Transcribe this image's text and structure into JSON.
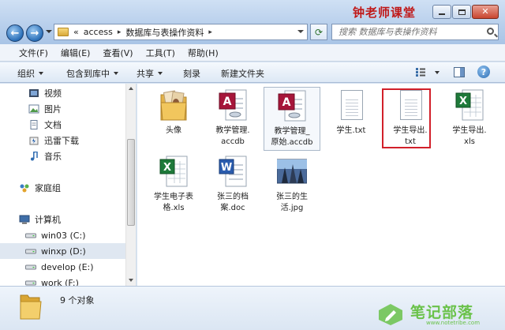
{
  "window": {
    "watermark_title": "钟老师课堂"
  },
  "address": {
    "prefix": "«",
    "crumbs": [
      "access",
      "数据库与表操作资料"
    ],
    "search_placeholder": "搜索 数据库与表操作资料"
  },
  "menu": [
    "文件(F)",
    "编辑(E)",
    "查看(V)",
    "工具(T)",
    "帮助(H)"
  ],
  "commands": {
    "organize": "组织",
    "include": "包含到库中",
    "share": "共享",
    "burn": "刻录",
    "new_folder": "新建文件夹"
  },
  "nav": [
    {
      "label": "视频",
      "icon": "video-icon"
    },
    {
      "label": "图片",
      "icon": "picture-icon"
    },
    {
      "label": "文档",
      "icon": "document-icon"
    },
    {
      "label": "迅雷下载",
      "icon": "thunder-icon"
    },
    {
      "label": "音乐",
      "icon": "music-icon"
    },
    {
      "label": "家庭组",
      "icon": "homegroup-icon"
    },
    {
      "label": "计算机",
      "icon": "computer-icon"
    },
    {
      "label": "win03 (C:)",
      "icon": "drive-icon"
    },
    {
      "label": "winxp (D:)",
      "icon": "drive-icon"
    },
    {
      "label": "develop (E:)",
      "icon": "drive-icon"
    },
    {
      "label": "work (F:)",
      "icon": "drive-icon"
    }
  ],
  "files": [
    {
      "name": "头像",
      "type": "folder-images"
    },
    {
      "name": "教学管理.accdb",
      "type": "access"
    },
    {
      "name": "教学管理_原始.accdb",
      "type": "access"
    },
    {
      "name": "学生.txt",
      "type": "text"
    },
    {
      "name": "学生导出.txt",
      "type": "text"
    },
    {
      "name": "学生导出.xls",
      "type": "excel"
    },
    {
      "name": "学生电子表格.xls",
      "type": "excel"
    },
    {
      "name": "张三的档案.doc",
      "type": "word"
    },
    {
      "name": "张三的生活.jpg",
      "type": "image"
    }
  ],
  "file_labels": [
    [
      "头像"
    ],
    [
      "教学管理.",
      "accdb"
    ],
    [
      "教学管理_",
      "原始.accdb"
    ],
    [
      "学生.txt"
    ],
    [
      "学生导出.",
      "txt"
    ],
    [
      "学生导出.",
      "xls"
    ],
    [
      "学生电子表",
      "格.xls"
    ],
    [
      "张三的档",
      "案.doc"
    ],
    [
      "张三的生",
      "活.jpg"
    ]
  ],
  "status": {
    "count_text": "9 个对象"
  },
  "watermark": {
    "text": "笔记部落",
    "url": "www.notetribe.com"
  },
  "colors": {
    "highlight_box": "#d2202a",
    "watermark": "#6ac24a",
    "title_mark": "#c01818"
  }
}
